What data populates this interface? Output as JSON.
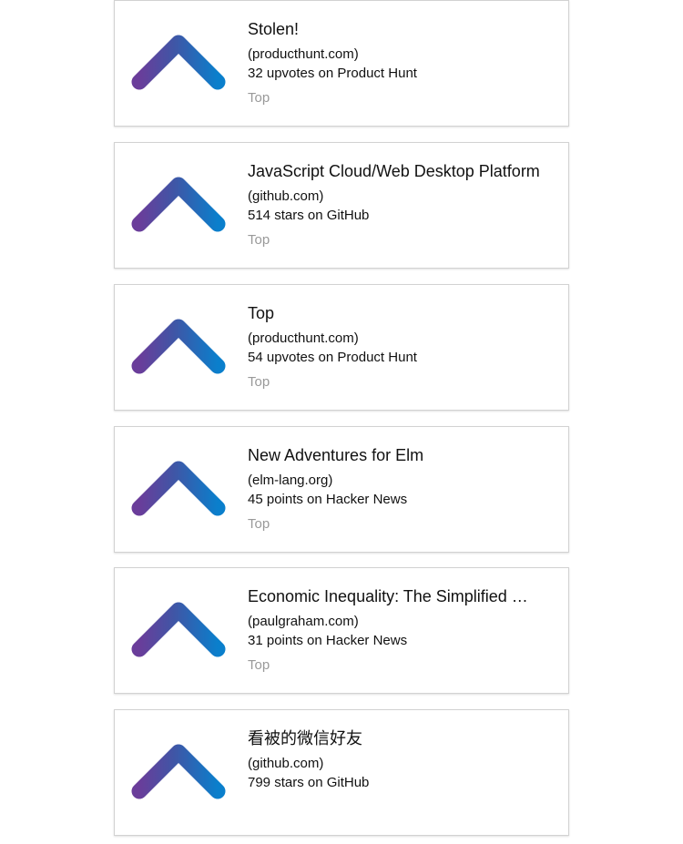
{
  "colors": {
    "chevron_start": "#6a3d9a",
    "chevron_mid": "#3f56a6",
    "chevron_end": "#0a7fcc",
    "tag_text": "#999999",
    "card_border": "#d2d2d2"
  },
  "icons": {
    "upvote": "chevron-up-icon"
  },
  "feed": {
    "items": [
      {
        "title": "Stolen!",
        "domain": "(producthunt.com)",
        "meta": "32 upvotes on Product Hunt",
        "tag": "Top"
      },
      {
        "title": "JavaScript Cloud/Web Desktop Platform",
        "domain": "(github.com)",
        "meta": "514 stars on GitHub",
        "tag": "Top"
      },
      {
        "title": "Top",
        "domain": "(producthunt.com)",
        "meta": "54 upvotes on Product Hunt",
        "tag": "Top"
      },
      {
        "title": "New Adventures for Elm",
        "domain": "(elm-lang.org)",
        "meta": "45 points on Hacker News",
        "tag": "Top"
      },
      {
        "title": "Economic Inequality: The Simplified …",
        "domain": "(paulgraham.com)",
        "meta": "31 points on Hacker News",
        "tag": "Top"
      },
      {
        "title": "看被的微信好友",
        "domain": "(github.com)",
        "meta": "799 stars on GitHub",
        "tag": ""
      }
    ]
  }
}
